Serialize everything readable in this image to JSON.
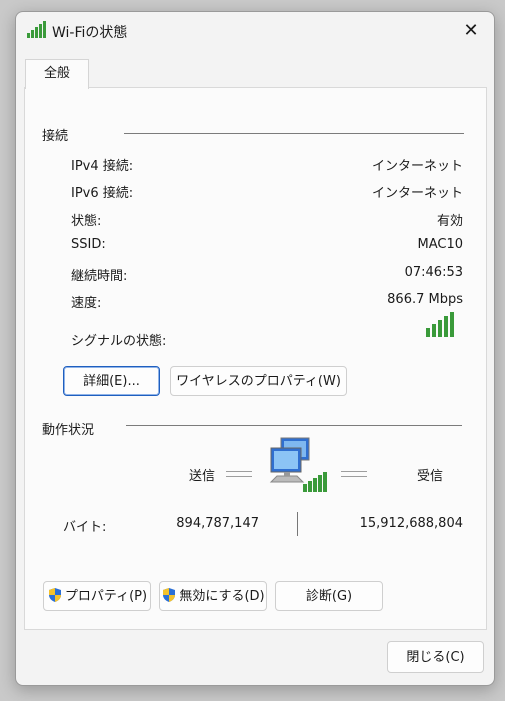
{
  "window": {
    "title": "Wi-Fiの状態",
    "close_glyph": "✕"
  },
  "tabs": [
    {
      "label": "全般"
    }
  ],
  "connection": {
    "title": "接続",
    "rows": [
      {
        "label": "IPv4 接続:",
        "value": "インターネット"
      },
      {
        "label": "IPv6 接続:",
        "value": "インターネット"
      },
      {
        "label": "状態:",
        "value": "有効"
      },
      {
        "label": "SSID:",
        "value": "MAC10"
      },
      {
        "label": "継続時間:",
        "value": "07:46:53"
      },
      {
        "label": "速度:",
        "value": "866.7 Mbps"
      }
    ],
    "signal_label": "シグナルの状態:",
    "signal_bars": 5,
    "signal_bars_max": 5,
    "details_button": "詳細(E)...",
    "wireless_properties_button": "ワイヤレスのプロパティ(W)"
  },
  "activity": {
    "title": "動作状況",
    "sent_label": "送信",
    "received_label": "受信",
    "bytes_label": "バイト:",
    "bytes_sent": "894,787,147",
    "bytes_received": "15,912,688,804"
  },
  "actions": {
    "properties_button": "プロパティ(P)",
    "disable_button": "無効にする(D)",
    "diagnose_button": "診断(G)"
  },
  "footer": {
    "close_button": "閉じる(C)"
  },
  "colors": {
    "signal_green": "#3a9a3a",
    "accent_blue": "#1f5fbf",
    "shield_blue": "#2a6fd6",
    "shield_yellow": "#f4c22b"
  },
  "icons": {
    "title": "wifi-signal-icon",
    "network": "network-computers-icon",
    "shield": "uac-shield-icon"
  }
}
